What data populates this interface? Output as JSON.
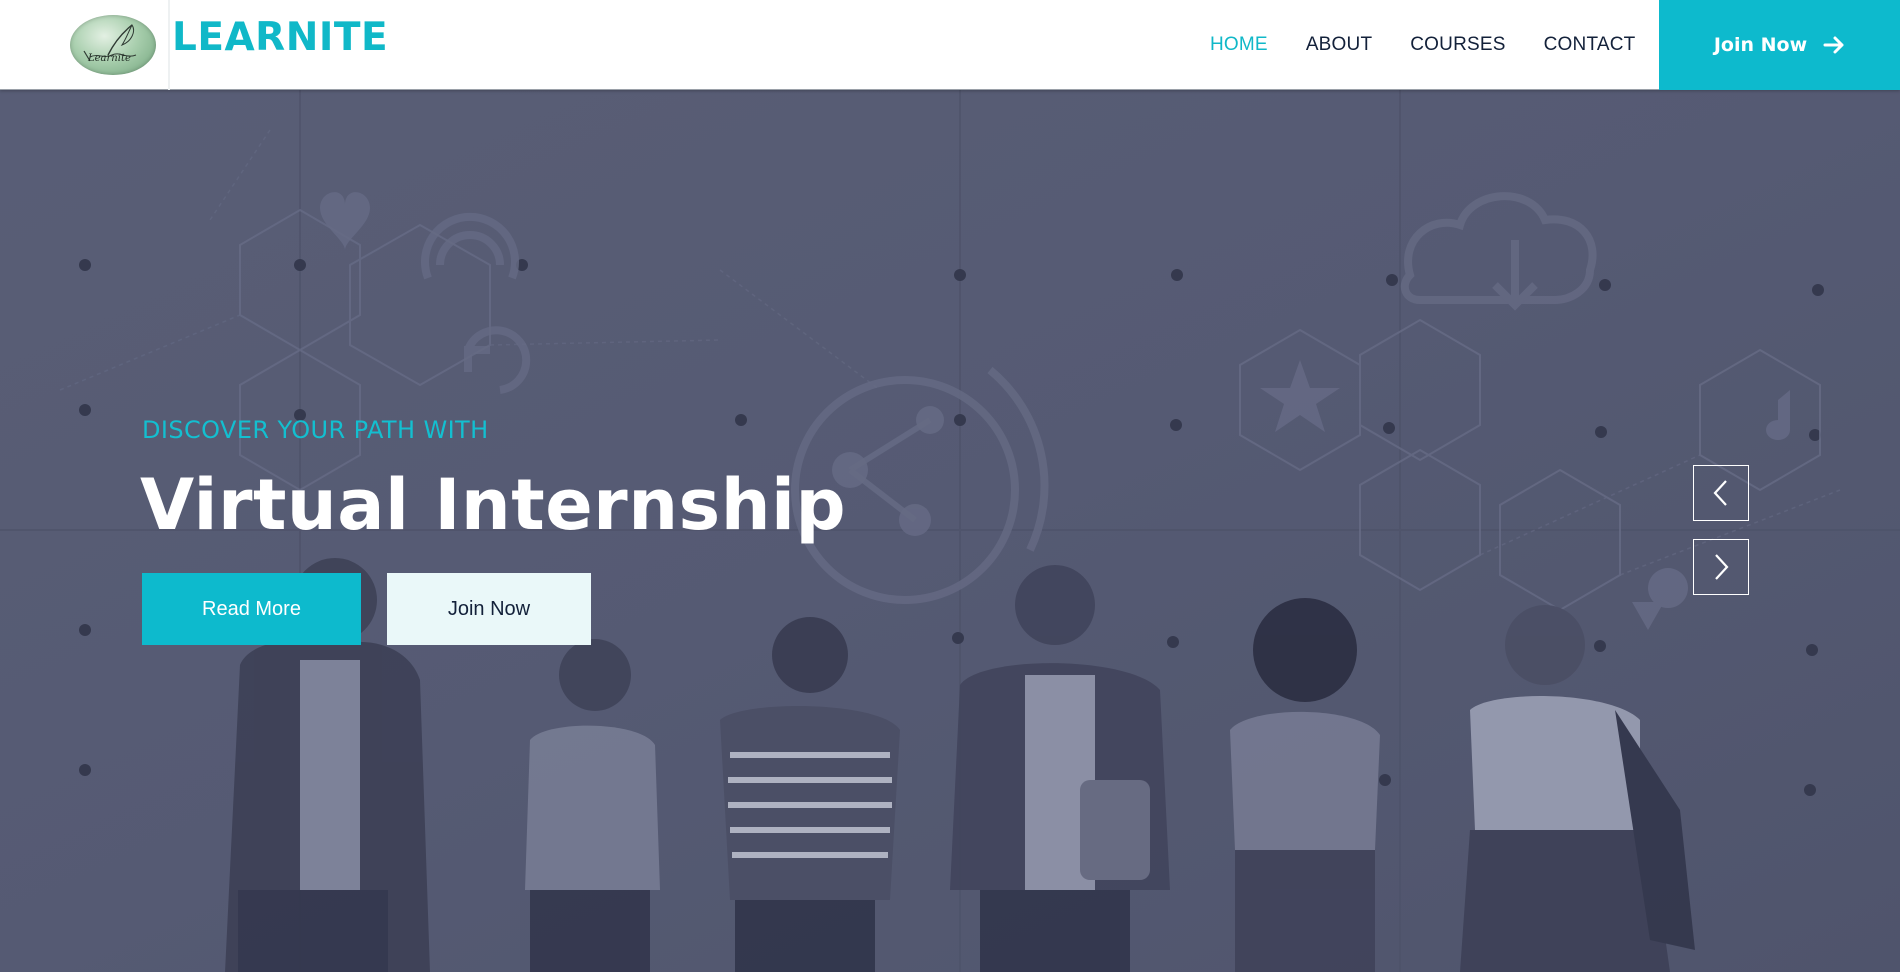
{
  "brand": {
    "name": "LEARNITE",
    "logo_text": "Learnite"
  },
  "nav": {
    "items": [
      {
        "label": "HOME",
        "active": true
      },
      {
        "label": "ABOUT",
        "active": false
      },
      {
        "label": "COURSES",
        "active": false
      },
      {
        "label": "CONTACT",
        "active": false
      }
    ]
  },
  "header_cta": {
    "label": "Join Now",
    "icon": "arrow-right-icon"
  },
  "hero": {
    "eyebrow": "DISCOVER YOUR PATH WITH",
    "title": "Virtual Internship",
    "primary_button": "Read More",
    "secondary_button": "Join Now",
    "prev_icon": "chevron-left-icon",
    "next_icon": "chevron-right-icon"
  },
  "colors": {
    "accent": "#0dbacd",
    "nav_text": "#13213a",
    "hero_overlay": "#555a72",
    "secondary_button_bg": "#eaf8f9"
  }
}
